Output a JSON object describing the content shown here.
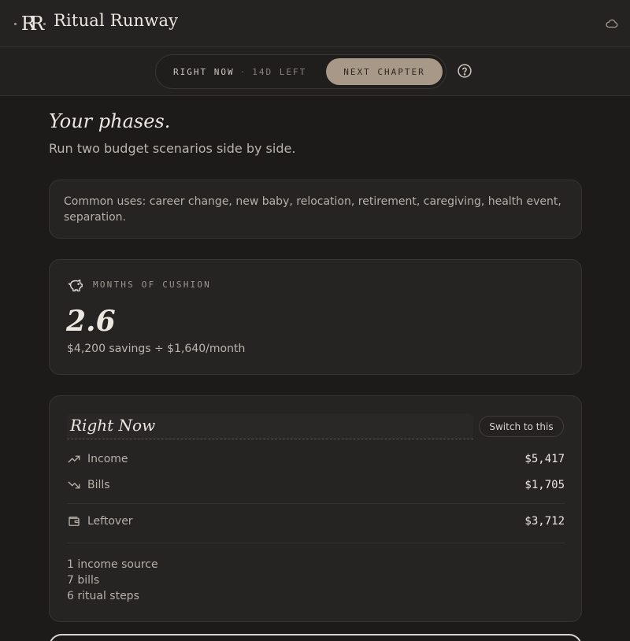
{
  "app": {
    "brand": "Ritual Runway",
    "logo_glyph": "RR"
  },
  "switcher": {
    "current_label": "RIGHT NOW",
    "separator": "·",
    "days_left": "14D LEFT",
    "next_label": "NEXT CHAPTER"
  },
  "page": {
    "title": "Your phases.",
    "subtitle": "Run two budget scenarios side by side."
  },
  "uses_card": {
    "text": "Common uses: career change, new baby, relocation, retirement, caregiving, health event, separation."
  },
  "cushion": {
    "label": "MONTHS OF CUSHION",
    "value": "2.6",
    "detail": "$4,200 savings ÷ $1,640/month"
  },
  "scenario": {
    "name": "Right Now",
    "switch_label": "Switch to this",
    "income_label": "Income",
    "income_value": "$5,417",
    "bills_label": "Bills",
    "bills_value": "$1,705",
    "leftover_label": "Leftover",
    "leftover_value": "$3,712",
    "stats": [
      "1 income source",
      "7 bills",
      "6 ritual steps"
    ]
  },
  "colors": {
    "background": "#1c1b1a",
    "accent": "#a89887",
    "text": "#ece7e0"
  },
  "icons": {
    "header_right": "cloud-icon",
    "help": "help-circle-icon",
    "cushion": "piggy-bank-icon",
    "income": "trend-up-icon",
    "bills": "trend-down-icon",
    "leftover": "wallet-icon"
  }
}
